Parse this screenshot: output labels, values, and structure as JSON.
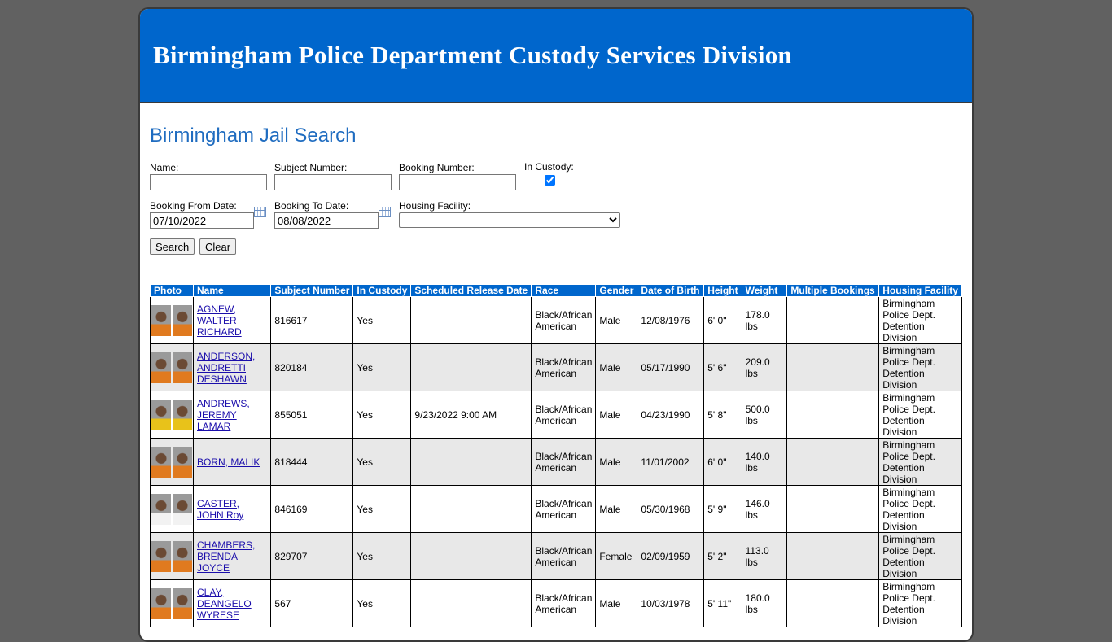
{
  "header": {
    "title": "Birmingham Police Department Custody Services Division"
  },
  "page_title": "Birmingham Jail Search",
  "form": {
    "name_label": "Name:",
    "name_value": "",
    "subject_label": "Subject Number:",
    "subject_value": "",
    "booking_label": "Booking Number:",
    "booking_value": "",
    "custody_label": "In Custody:",
    "custody_checked": true,
    "from_label": "Booking From Date:",
    "from_value": "07/10/2022",
    "to_label": "Booking To Date:",
    "to_value": "08/08/2022",
    "facility_label": "Housing Facility:",
    "facility_value": "",
    "search_label": "Search",
    "clear_label": "Clear"
  },
  "table": {
    "headers": [
      "Photo",
      "Name",
      "Subject Number",
      "In Custody",
      "Scheduled Release Date",
      "Race",
      "Gender",
      "Date of Birth",
      "Height",
      "Weight",
      "Multiple Bookings",
      "Housing Facility"
    ],
    "rows": [
      {
        "name": "AGNEW, WALTER RICHARD",
        "subject": "816617",
        "custody": "Yes",
        "release": "",
        "race": "Black/African American",
        "gender": "Male",
        "dob": "12/08/1976",
        "height": "6' 0\"",
        "weight": "178.0 lbs",
        "multiple": "",
        "facility": "Birmingham Police Dept. Detention Division",
        "photo": "orange"
      },
      {
        "name": "ANDERSON, ANDRETTI DESHAWN",
        "subject": "820184",
        "custody": "Yes",
        "release": "",
        "race": "Black/African American",
        "gender": "Male",
        "dob": "05/17/1990",
        "height": "5' 6\"",
        "weight": "209.0 lbs",
        "multiple": "",
        "facility": "Birmingham Police Dept. Detention Division",
        "photo": "orange"
      },
      {
        "name": "ANDREWS, JEREMY LAMAR",
        "subject": "855051",
        "custody": "Yes",
        "release": "9/23/2022 9:00 AM",
        "race": "Black/African American",
        "gender": "Male",
        "dob": "04/23/1990",
        "height": "5' 8\"",
        "weight": "500.0 lbs",
        "multiple": "",
        "facility": "Birmingham Police Dept. Detention Division",
        "photo": "yellow"
      },
      {
        "name": "BORN, MALIK",
        "subject": "818444",
        "custody": "Yes",
        "release": "",
        "race": "Black/African American",
        "gender": "Male",
        "dob": "11/01/2002",
        "height": "6' 0\"",
        "weight": "140.0 lbs",
        "multiple": "",
        "facility": "Birmingham Police Dept. Detention Division",
        "photo": "orange"
      },
      {
        "name": "CASTER, JOHN Roy",
        "subject": "846169",
        "custody": "Yes",
        "release": "",
        "race": "Black/African American",
        "gender": "Male",
        "dob": "05/30/1968",
        "height": "5' 9\"",
        "weight": "146.0 lbs",
        "multiple": "",
        "facility": "Birmingham Police Dept. Detention Division",
        "photo": "white"
      },
      {
        "name": "CHAMBERS, BRENDA JOYCE",
        "subject": "829707",
        "custody": "Yes",
        "release": "",
        "race": "Black/African American",
        "gender": "Female",
        "dob": "02/09/1959",
        "height": "5' 2\"",
        "weight": "113.0 lbs",
        "multiple": "",
        "facility": "Birmingham Police Dept. Detention Division",
        "photo": "orange"
      },
      {
        "name": "CLAY, DEANGELO WYRESE",
        "subject": "567",
        "custody": "Yes",
        "release": "",
        "race": "Black/African American",
        "gender": "Male",
        "dob": "10/03/1978",
        "height": "5' 11\"",
        "weight": "180.0 lbs",
        "multiple": "",
        "facility": "Birmingham Police Dept. Detention Division",
        "photo": "orange"
      }
    ]
  }
}
